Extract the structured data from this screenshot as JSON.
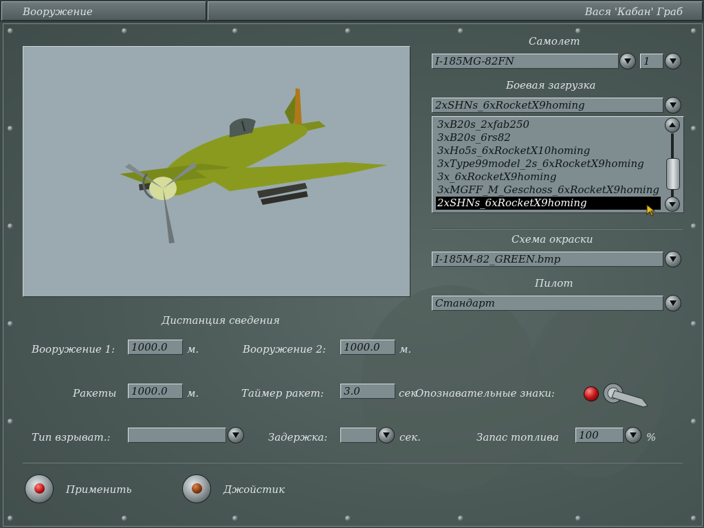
{
  "window": {
    "title": "Вооружение",
    "user": "Вася 'Кабан' Граб"
  },
  "aircraft": {
    "label": "Самолет",
    "value": "I-185MG-82FN",
    "count": "1"
  },
  "loadout": {
    "label": "Боевая загрузка",
    "value": "2xSHNs_6xRocketX9homing",
    "items": [
      "3xB20s_2xfab250",
      "3xB20s_6rs82",
      "3xHo5s_6xRocketX10homing",
      "3xType99model_2s_6xRocketX9homing",
      "3x_6xRocketX9homing",
      "3xMGFF_M_Geschoss_6xRocketX9homing",
      "2xSHNs_6xRocketX9homing"
    ],
    "selected_index": 6
  },
  "skin": {
    "label": "Схема окраски",
    "value": "I-185M-82_GREEN.bmp"
  },
  "pilot": {
    "label": "Пилот",
    "value": "Стандарт"
  },
  "convergence": {
    "heading": "Дистанция сведения",
    "weapon1_label": "Вооружение 1:",
    "weapon1_value": "1000.0",
    "weapon1_unit": "м.",
    "weapon2_label": "Вооружение 2:",
    "weapon2_value": "1000.0",
    "weapon2_unit": "м.",
    "rockets_label": "Ракеты",
    "rockets_value": "1000.0",
    "rockets_unit": "м.",
    "timer_label": "Таймер ракет:",
    "timer_value": "3.0",
    "timer_unit": "сек"
  },
  "markings": {
    "label": "Опознавательные знаки:"
  },
  "fuse": {
    "label": "Тип взрыват.:",
    "value": ""
  },
  "delay": {
    "label": "Задержка:",
    "value": "",
    "unit": "сек."
  },
  "fuel": {
    "label": "Запас топлива",
    "value": "100",
    "unit": "%"
  },
  "buttons": {
    "apply": "Применить",
    "joystick": "Джойстик"
  },
  "colors": {
    "aircraft_body": "#8a9a1e",
    "lamp_red": "#c01414",
    "lamp_amber": "#8a3a10"
  }
}
